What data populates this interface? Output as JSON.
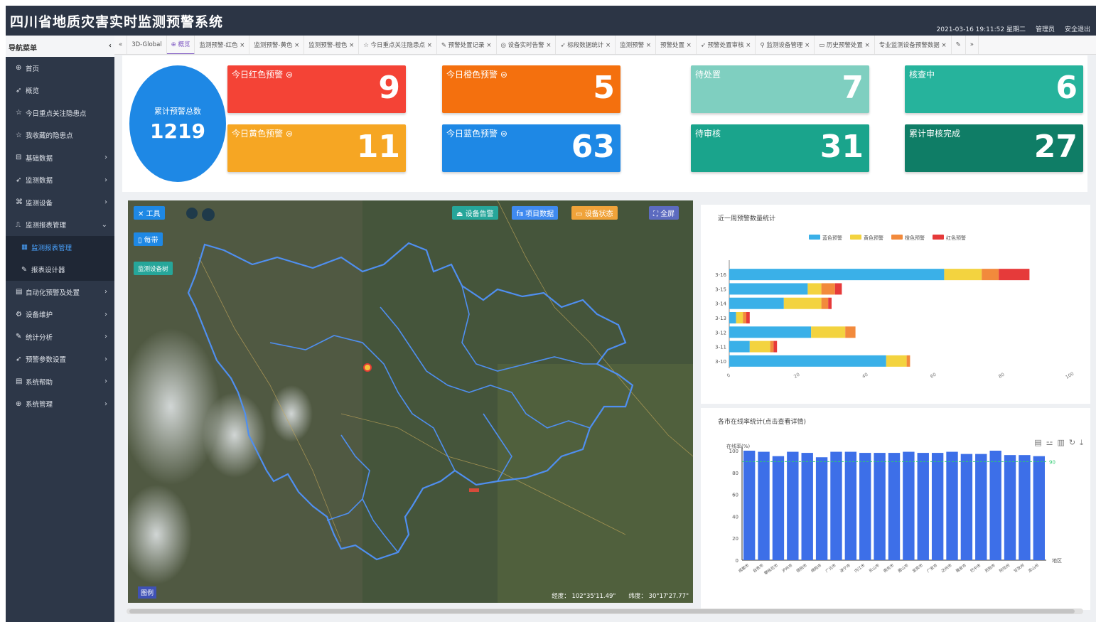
{
  "header": {
    "title": "四川省地质灾害实时监测预警系统",
    "datetime": "2021-03-16 19:11:52 星期二",
    "user": "管理员",
    "logout": "安全退出"
  },
  "sidebar": {
    "header": "导航菜单",
    "collapse": "‹",
    "items": [
      {
        "label": "首页",
        "icon": "globe-icon",
        "glyph": "⊕",
        "chevron": false
      },
      {
        "label": "概览",
        "icon": "send-icon",
        "glyph": "➶",
        "chevron": false
      },
      {
        "label": "今日重点关注隐患点",
        "icon": "star-icon",
        "glyph": "☆",
        "chevron": false
      },
      {
        "label": "我收藏的隐患点",
        "icon": "star-icon",
        "glyph": "☆",
        "chevron": false
      },
      {
        "label": "基础数据",
        "icon": "database-icon",
        "glyph": "⊟",
        "chevron": true
      },
      {
        "label": "监测数据",
        "icon": "send-icon",
        "glyph": "➶",
        "chevron": true
      },
      {
        "label": "监测设备",
        "icon": "device-icon",
        "glyph": "⌘",
        "chevron": true
      },
      {
        "label": "监测报表管理",
        "icon": "chart-icon",
        "glyph": "⎍",
        "chevron": true
      }
    ],
    "sub_items": [
      {
        "label": "监测报表管理",
        "icon": "table-icon",
        "glyph": "▦",
        "active": true
      },
      {
        "label": "报表设计器",
        "icon": "pencil-icon",
        "glyph": "✎",
        "active": false
      }
    ],
    "items_after": [
      {
        "label": "自动化预警及处置",
        "icon": "list-icon",
        "glyph": "▤",
        "chevron": true
      },
      {
        "label": "设备维护",
        "icon": "gear-icon",
        "glyph": "⚙",
        "chevron": true
      },
      {
        "label": "统计分析",
        "icon": "pencil-icon",
        "glyph": "✎",
        "chevron": true
      },
      {
        "label": "预警参数设置",
        "icon": "send-icon",
        "glyph": "➶",
        "chevron": true
      },
      {
        "label": "系统帮助",
        "icon": "list-icon",
        "glyph": "▤",
        "chevron": true
      },
      {
        "label": "系统管理",
        "icon": "globe-icon",
        "glyph": "⊕",
        "chevron": true
      }
    ]
  },
  "tabs": [
    {
      "label": "«",
      "active": false
    },
    {
      "label": "3D-Global",
      "active": false
    },
    {
      "label": "⊕ 概览",
      "active": true
    },
    {
      "label": "监测预警-红色 ×",
      "active": false
    },
    {
      "label": "监测预警-黄色 ×",
      "active": false
    },
    {
      "label": "监测预警-橙色 ×",
      "active": false
    },
    {
      "label": "☆ 今日重点关注隐患点 ×",
      "active": false
    },
    {
      "label": "✎ 预警处置记录 ×",
      "active": false
    },
    {
      "label": "◎ 设备实时告警 ×",
      "active": false
    },
    {
      "label": "➶ 标段数据统计 ×",
      "active": false
    },
    {
      "label": "监测预警 ×",
      "active": false
    },
    {
      "label": "预警处置 ×",
      "active": false
    },
    {
      "label": "➶ 预警处置审核 ×",
      "active": false
    },
    {
      "label": "⚲ 监测设备管理 ×",
      "active": false
    },
    {
      "label": "▭ 历史预警处置 ×",
      "active": false
    },
    {
      "label": "专业监测设备预警数据 ×",
      "active": false
    },
    {
      "label": "✎",
      "active": false
    },
    {
      "label": "»",
      "active": false
    }
  ],
  "stats": {
    "total_label": "累计预警总数",
    "total_value": "1219",
    "cards": [
      {
        "label": "今日红色预警 ⊜",
        "value": "9",
        "color": "#f44336"
      },
      {
        "label": "今日橙色预警 ⊜",
        "value": "5",
        "color": "#f4700e"
      },
      {
        "label": "待处置",
        "value": "7",
        "color": "#7fcfc0"
      },
      {
        "label": "核查中",
        "value": "6",
        "color": "#26b39c"
      },
      {
        "label": "今日黄色预警 ⊜",
        "value": "11",
        "color": "#f6a623"
      },
      {
        "label": "今日蓝色预警 ⊜",
        "value": "63",
        "color": "#1e88e5"
      },
      {
        "label": "待审核",
        "value": "31",
        "color": "#1aa48c"
      },
      {
        "label": "累计审核完成",
        "value": "27",
        "color": "#0f7d66"
      }
    ]
  },
  "map": {
    "tool_btn": "✕ 工具",
    "tree_btn": "▯ 每带",
    "device_tree_btn": "监测设备树",
    "alarm_btn": "⏏ 设备告警",
    "project_btn": "㎙ 项目数据",
    "status_btn": "▭ 设备状态",
    "fullscreen_btn": "⛶ 全屏",
    "lon": "经度： 102°35'11.49\"",
    "lat": "纬度： 30°17'27.77\"",
    "legend": "图例"
  },
  "chart1": {
    "title": "近一周预警数量统计",
    "legend": [
      "蓝色预警",
      "黄色预警",
      "橙色预警",
      "红色预警"
    ],
    "colors": [
      "#3ab0e8",
      "#f3d33f",
      "#f28a3c",
      "#e63a3a"
    ]
  },
  "chart2": {
    "title": "各市在线率统计(点击查看详情)",
    "ylabel": "在线率(%)",
    "xlabel": "地区",
    "markline": "90",
    "toolbar_icons": [
      "data-view-icon",
      "line-icon",
      "bar-icon",
      "restore-icon",
      "download-icon"
    ],
    "toolbar_glyphs": [
      "▤",
      "⚍",
      "▥",
      "↻",
      "⤓"
    ]
  },
  "chart_data": [
    {
      "type": "bar",
      "orientation": "horizontal",
      "stacked": true,
      "title": "近一周预警数量统计",
      "categories": [
        "3-10",
        "3-11",
        "3-12",
        "3-13",
        "3-14",
        "3-15",
        "3-16"
      ],
      "series": [
        {
          "name": "蓝色预警",
          "values": [
            46,
            6,
            24,
            2,
            16,
            23,
            63
          ]
        },
        {
          "name": "黄色预警",
          "values": [
            6,
            6,
            10,
            2,
            11,
            4,
            11
          ]
        },
        {
          "name": "橙色预警",
          "values": [
            1,
            1,
            3,
            1,
            2,
            4,
            5
          ]
        },
        {
          "name": "红色预警",
          "values": [
            0,
            1,
            0,
            1,
            1,
            2,
            9
          ]
        }
      ],
      "xlim": [
        0,
        100
      ],
      "xticks": [
        "0",
        "20",
        "40",
        "60",
        "80",
        "100"
      ]
    },
    {
      "type": "bar",
      "title": "各市在线率统计(点击查看详情)",
      "ylabel": "在线率(%)",
      "xlabel": "地区",
      "categories": [
        "成都市",
        "自贡市",
        "攀枝花市",
        "泸州市",
        "德阳市",
        "绵阳市",
        "广元市",
        "遂宁市",
        "内江市",
        "乐山市",
        "南充市",
        "眉山市",
        "宜宾市",
        "广安市",
        "达州市",
        "雅安市",
        "巴中市",
        "资阳市",
        "阿坝州",
        "甘孜州",
        "凉山州"
      ],
      "values": [
        100,
        99,
        95,
        99,
        98,
        94,
        99,
        99,
        98,
        98,
        98,
        99,
        98,
        98,
        99,
        97,
        97,
        100,
        96,
        96,
        95
      ],
      "ylim": [
        0,
        100
      ],
      "yticks": [
        "0",
        "20",
        "40",
        "60",
        "80",
        "100"
      ],
      "markline": 90
    }
  ]
}
